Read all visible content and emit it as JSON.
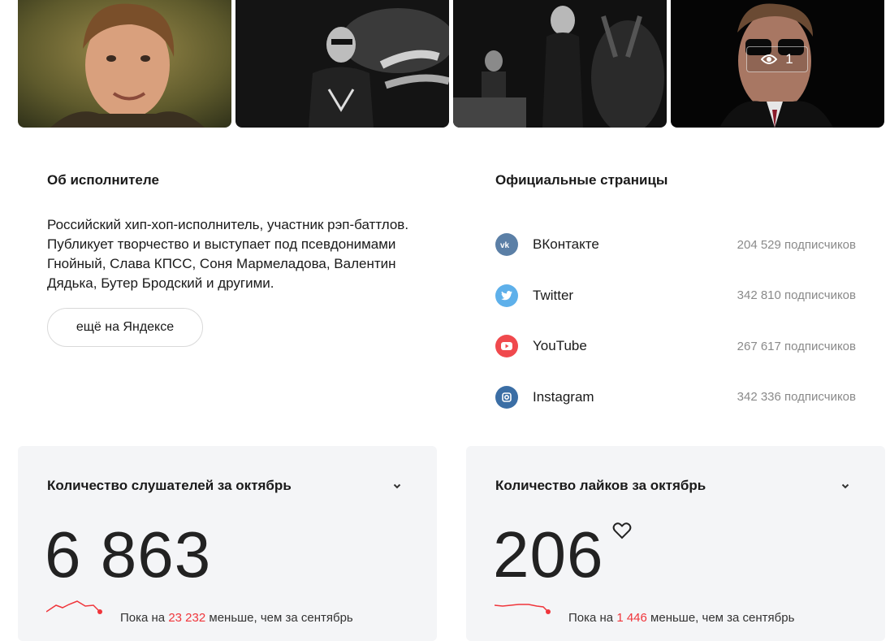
{
  "gallery": {
    "views_count": "1"
  },
  "about": {
    "title": "Об исполнителе",
    "text": "Российский хип-хоп-исполнитель, участник рэп-баттлов. Публикует творчество и выступает под псевдонимами Гнойный, Слава КПСС, Соня Мармеладова, Валентин Дядька, Бутер Бродский и другими.",
    "more_button": "ещё на Яндексе"
  },
  "official": {
    "title": "Официальные страницы",
    "items": [
      {
        "name": "ВКонтакте",
        "subscribers": "204 529 подписчиков",
        "icon": "vk-icon",
        "color": "#5b7fa6"
      },
      {
        "name": "Twitter",
        "subscribers": "342 810 подписчиков",
        "icon": "twitter-icon",
        "color": "#5eb0ea"
      },
      {
        "name": "YouTube",
        "subscribers": "267 617 подписчиков",
        "icon": "youtube-icon",
        "color": "#f0494d"
      },
      {
        "name": "Instagram",
        "subscribers": "342 336 подписчиков",
        "icon": "instagram-icon",
        "color": "#3b6ea5"
      }
    ]
  },
  "stats": {
    "listeners": {
      "title": "Количество слушателей за октябрь",
      "value": "6 863",
      "cmp_prefix": "Пока на ",
      "cmp_diff": "23 232",
      "cmp_suffix": " меньше, чем за сентябрь"
    },
    "likes": {
      "title": "Количество лайков за октябрь",
      "value": "206",
      "cmp_prefix": "Пока на ",
      "cmp_diff": "1 446",
      "cmp_suffix": " меньше, чем за сентябрь"
    }
  },
  "colors": {
    "accent_red": "#f0353b",
    "card_bg": "#f4f5f7"
  }
}
